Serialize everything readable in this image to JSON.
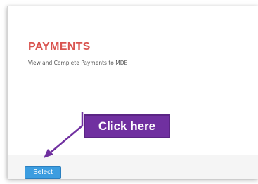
{
  "panel": {
    "title": "PAYMENTS",
    "description": "View and Complete Payments to MDE"
  },
  "footer": {
    "select_label": "Select"
  },
  "annotation": {
    "callout_text": "Click here"
  },
  "colors": {
    "title": "#d9534f",
    "button": "#3c9de0",
    "callout": "#7030a0"
  }
}
